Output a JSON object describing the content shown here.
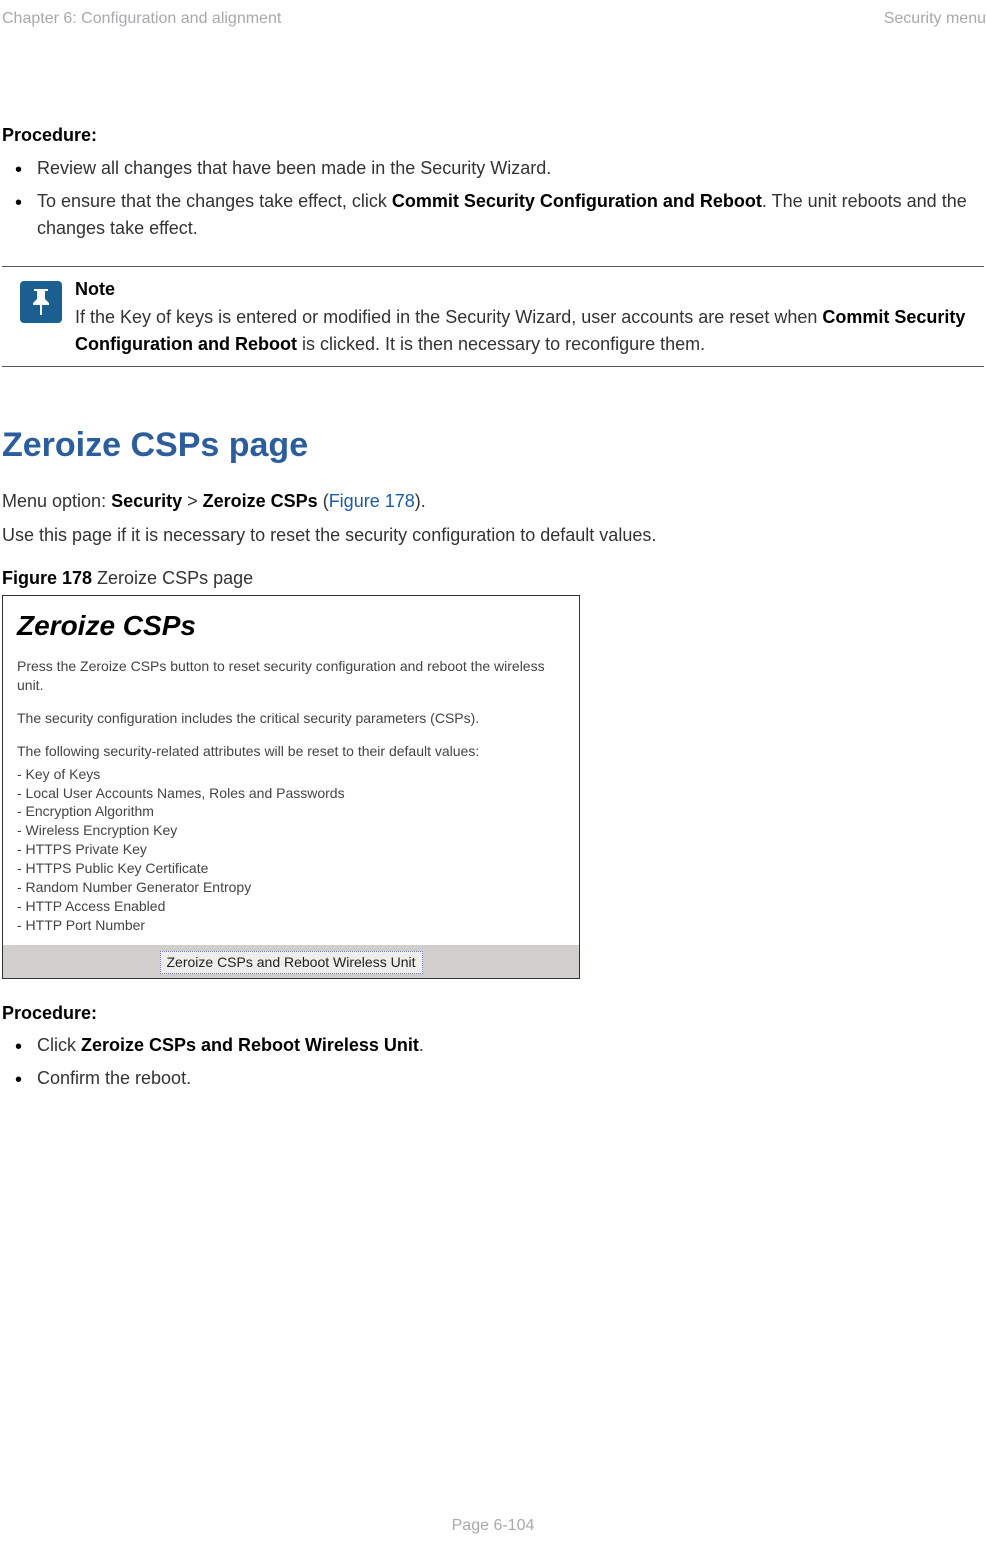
{
  "header": {
    "left": "Chapter 6:  Configuration and alignment",
    "right": "Security menu"
  },
  "procedure1": {
    "heading": "Procedure:",
    "items": [
      {
        "text": "Review all changes that have been made in the Security Wizard."
      },
      {
        "prefix": "To ensure that the changes take effect, click ",
        "bold": "Commit Security Configuration and Reboot",
        "suffix": ". The unit reboots and the changes take effect."
      }
    ]
  },
  "note": {
    "label": "Note",
    "prefix": "If the Key of keys is entered or modified in the Security Wizard, user accounts are reset when ",
    "bold": "Commit Security Configuration and Reboot",
    "suffix": " is clicked. It is then necessary to reconfigure them."
  },
  "section": {
    "heading": "Zeroize CSPs page",
    "menu_prefix": "Menu option: ",
    "menu_sec": "Security",
    "menu_gt": " > ",
    "menu_zero": "Zeroize CSPs",
    "menu_paren_open": " (",
    "menu_link": "Figure 178",
    "menu_paren_close": ").",
    "desc": "Use this page if it is necessary to reset the security configuration to default values."
  },
  "figure": {
    "caption_bold": "Figure 178",
    "caption_rest": "  Zeroize CSPs page",
    "title": "Zeroize CSPs",
    "para1": "Press the Zeroize CSPs button to reset security configuration and reboot the wireless unit.",
    "para2": "The security configuration includes the critical security parameters (CSPs).",
    "para3": "The following security-related attributes will be reset to their default values:",
    "items": [
      "- Key of Keys",
      "- Local User Accounts Names, Roles and Passwords",
      "- Encryption Algorithm",
      "- Wireless Encryption Key",
      "- HTTPS Private Key",
      "- HTTPS Public Key Certificate",
      "- Random Number Generator Entropy",
      "- HTTP Access Enabled",
      "- HTTP Port Number"
    ],
    "button": "Zeroize CSPs and Reboot Wireless Unit"
  },
  "procedure2": {
    "heading": "Procedure:",
    "item1_prefix": "Click ",
    "item1_bold": "Zeroize CSPs and Reboot Wireless Unit",
    "item1_suffix": ".",
    "item2": "Confirm the reboot."
  },
  "footer": "Page 6-104"
}
